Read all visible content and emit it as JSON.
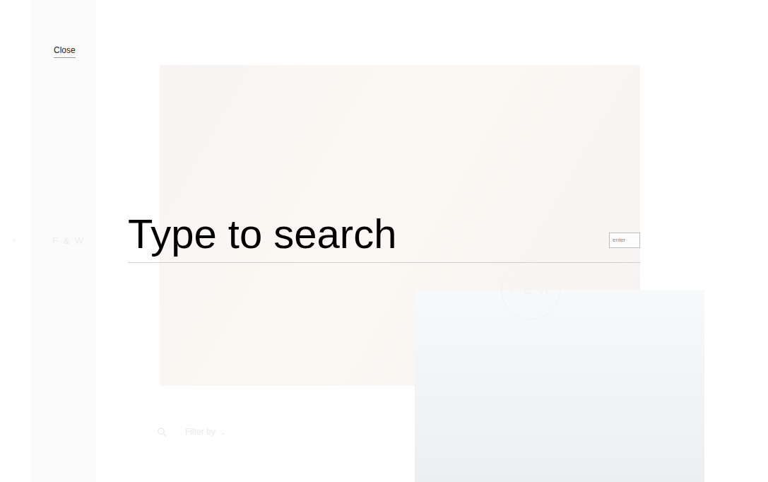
{
  "close": "Close",
  "sidebar": {
    "arrow": "‹",
    "logo": "F & W"
  },
  "search": {
    "placeholder": "Type to search",
    "button": "enter"
  },
  "background": {
    "badge": "F & W",
    "filter": "Filter by",
    "filter_arrow": "⌄"
  }
}
